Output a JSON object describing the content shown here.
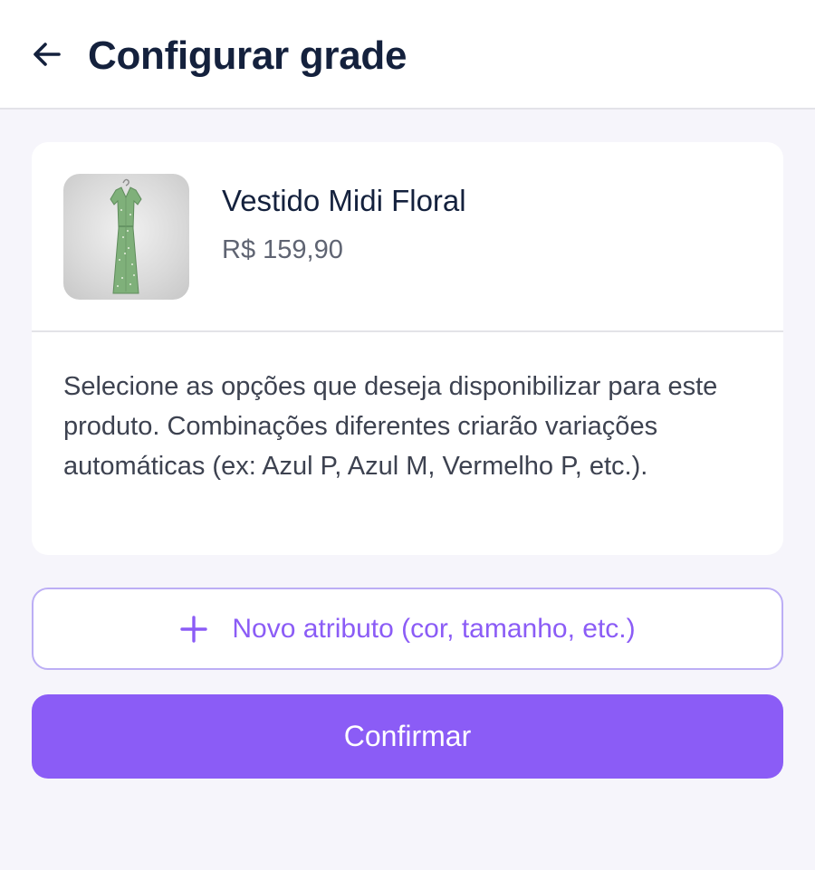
{
  "header": {
    "back_icon": "arrow-left-icon",
    "title": "Configurar grade"
  },
  "product": {
    "image_icon": "dress-thumbnail",
    "name": "Vestido Midi Floral",
    "price": "R$ 159,90"
  },
  "description": "Selecione as opções que deseja disponibilizar para este produto. Combinações diferentes criarão variações automáticas (ex: Azul P, Azul M, Vermelho P, etc.).",
  "actions": {
    "add_attribute_icon": "plus-icon",
    "add_attribute_label": "Novo atributo (cor, tamanho, etc.)",
    "confirm_label": "Confirmar"
  },
  "colors": {
    "accent": "#8b5cf6",
    "accent_border": "#bcaef5",
    "background": "#f6f5fb",
    "text_primary": "#14213d"
  }
}
